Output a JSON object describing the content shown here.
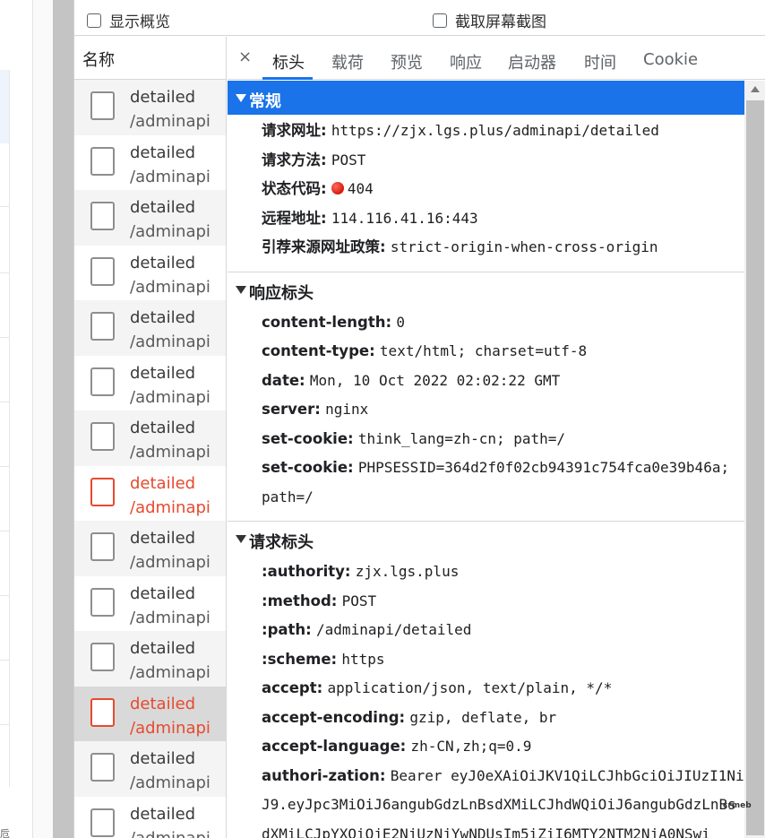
{
  "toolbar": {
    "overview_label": "显示概览",
    "screenshot_label": "截取屏幕截图"
  },
  "request_list": {
    "header": "名称",
    "items": [
      {
        "name": "detailed",
        "path": "/adminapi",
        "status": "ok"
      },
      {
        "name": "detailed",
        "path": "/adminapi",
        "status": "ok"
      },
      {
        "name": "detailed",
        "path": "/adminapi",
        "status": "ok"
      },
      {
        "name": "detailed",
        "path": "/adminapi",
        "status": "ok"
      },
      {
        "name": "detailed",
        "path": "/adminapi",
        "status": "ok"
      },
      {
        "name": "detailed",
        "path": "/adminapi",
        "status": "ok"
      },
      {
        "name": "detailed",
        "path": "/adminapi",
        "status": "ok"
      },
      {
        "name": "detailed",
        "path": "/adminapi",
        "status": "error"
      },
      {
        "name": "detailed",
        "path": "/adminapi",
        "status": "ok"
      },
      {
        "name": "detailed",
        "path": "/adminapi",
        "status": "ok"
      },
      {
        "name": "detailed",
        "path": "/adminapi",
        "status": "ok"
      },
      {
        "name": "detailed",
        "path": "/adminapi",
        "status": "error"
      },
      {
        "name": "detailed",
        "path": "/adminapi",
        "status": "ok"
      },
      {
        "name": "detailed",
        "path": "/adminapi",
        "status": "ok"
      }
    ]
  },
  "tabs": {
    "close_icon": "×",
    "items": [
      "标头",
      "载荷",
      "预览",
      "响应",
      "启动器",
      "时间",
      "Cookie"
    ],
    "active": "标头"
  },
  "general": {
    "title": "常规",
    "url_key": "请求网址:",
    "url": "https://zjx.lgs.plus/adminapi/detailed",
    "method_key": "请求方法:",
    "method": "POST",
    "status_key": "状态代码:",
    "status": "404",
    "status_color": "#d93025",
    "remote_key": "远程地址:",
    "remote": "114.116.41.16:443",
    "referrer_key": "引荐来源网址政策:",
    "referrer": "strict-origin-when-cross-origin"
  },
  "response_headers": {
    "title": "响应标头",
    "items": [
      {
        "k": "content-length:",
        "v": "0"
      },
      {
        "k": "content-type:",
        "v": "text/html; charset=utf-8"
      },
      {
        "k": "date:",
        "v": "Mon, 10 Oct 2022 02:02:22 GMT"
      },
      {
        "k": "server:",
        "v": "nginx"
      },
      {
        "k": "set-cookie:",
        "v": "think_lang=zh-cn; path=/"
      },
      {
        "k": "set-cookie:",
        "v": "PHPSESSID=364d2f0f02cb94391c754fca0e39b46a; path=/"
      }
    ]
  },
  "request_headers": {
    "title": "请求标头",
    "items": [
      {
        "k": ":authority:",
        "v": "zjx.lgs.plus"
      },
      {
        "k": ":method:",
        "v": "POST"
      },
      {
        "k": ":path:",
        "v": "/adminapi/detailed"
      },
      {
        "k": ":scheme:",
        "v": "https"
      },
      {
        "k": "accept:",
        "v": "application/json, text/plain, */*"
      },
      {
        "k": "accept-encoding:",
        "v": "gzip, deflate, br"
      },
      {
        "k": "accept-language:",
        "v": "zh-CN,zh;q=0.9"
      },
      {
        "k": "authori-zation:",
        "v": "Bearer eyJ0eXAiOiJKV1QiLCJhbGciOiJIUzI1NiJ9.eyJpc3MiOiJ6angubGdzLnBsdXMiLCJhdWQiOiJ6angubGdzLnBsdXMiLCJpYXQiOjE2NjUzNjYwNDUsIm5iZiI6MTY2NTM2NjA0NSwi"
      }
    ]
  },
  "left_page": {
    "glyph": "卮"
  },
  "watermark": "crmeb",
  "colors": {
    "accent": "#1a73e8",
    "error": "#e64a2e"
  }
}
